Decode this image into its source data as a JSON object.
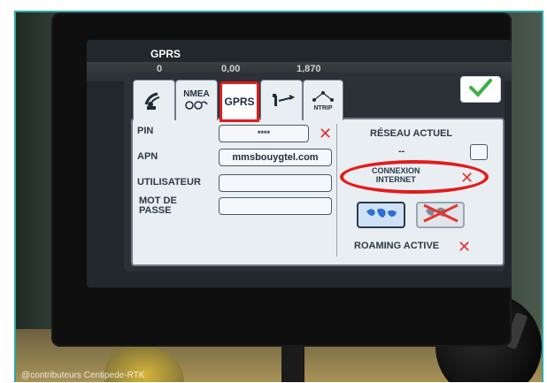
{
  "screen": {
    "title": "GPRS",
    "status": {
      "a": "0",
      "b": "0,00",
      "c": "1,870"
    }
  },
  "tabs": [
    {
      "label": "",
      "icon": "satellite-dish-icon"
    },
    {
      "label": "NMEA",
      "icon": "sensor-icon"
    },
    {
      "label": "GPRS",
      "selected": true
    },
    {
      "label": "",
      "icon": "wrench-icon"
    },
    {
      "label": "NTRIP",
      "icon": "network-icon"
    }
  ],
  "form": {
    "pin": {
      "label": "PIN",
      "value": "****"
    },
    "apn": {
      "label": "APN",
      "value": "mmsbouygtel.com"
    },
    "user": {
      "label": "UTILISATEUR",
      "value": ""
    },
    "password": {
      "label_line1": "MOT DE",
      "label_line2": "PASSE",
      "value": ""
    }
  },
  "right": {
    "network_label": "RÉSEAU ACTUEL",
    "network_value": "--",
    "connection_line1": "CONNEXION",
    "connection_line2": "INTERNET",
    "roaming_label": "ROAMING ACTIVE"
  },
  "watermark": "@contributeurs Centipede-RTK",
  "colors": {
    "red": "#e21b1b",
    "green": "#3cb043",
    "blue": "#2f6fd1"
  }
}
